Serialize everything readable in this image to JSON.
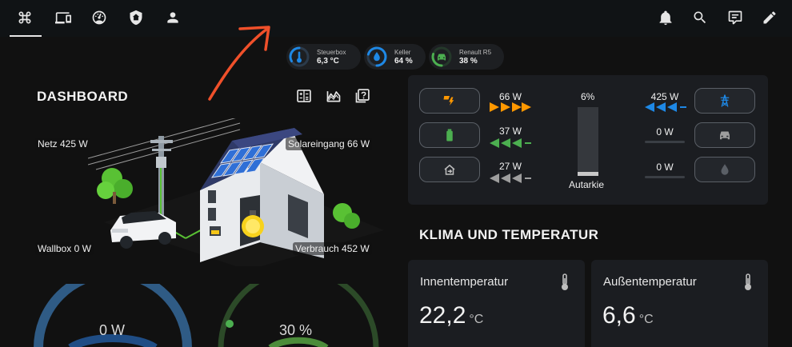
{
  "topbar": {
    "tabs": [
      {
        "icon": "command-icon",
        "active": true
      },
      {
        "icon": "devices-icon",
        "active": false
      },
      {
        "icon": "gauge-icon",
        "active": false
      },
      {
        "icon": "home-shield-icon",
        "active": false
      },
      {
        "icon": "person-icon",
        "active": false
      }
    ],
    "actions": [
      "bell-icon",
      "search-icon",
      "chat-icon",
      "pencil-icon"
    ]
  },
  "chips": [
    {
      "name": "Steuerbox",
      "value": "6,3 °C",
      "icon": "thermometer-icon",
      "color": "#1e88e5",
      "fill": 0.3
    },
    {
      "name": "Keller",
      "value": "64 %",
      "icon": "water-drop-icon",
      "color": "#1e88e5",
      "fill": 0.64
    },
    {
      "name": "Renault R5",
      "value": "38 %",
      "icon": "car-icon",
      "color": "#4caf50",
      "fill": 0.38
    }
  ],
  "dashboard": {
    "title": "DASHBOARD",
    "tools": [
      "solar-calc-icon",
      "chart-area-icon",
      "help-box-icon"
    ],
    "labels": {
      "grid": "Netz 425 W",
      "solar": "Solareingang 66 W",
      "wallbox": "Wallbox 0 W",
      "consumption": "Verbrauch 452 W"
    }
  },
  "gauges": [
    {
      "value": "0 W",
      "color": "#2f5b85",
      "fill": 0.0
    },
    {
      "value": "30 %",
      "color": "#4c8c3a",
      "fill": 0.3
    }
  ],
  "energy": {
    "solar": {
      "value": "66 W",
      "color": "#ff9800"
    },
    "battery": {
      "value": "37 W",
      "color": "#4caf50"
    },
    "home": {
      "value": "27 W",
      "color": "#9e9e9e"
    },
    "grid": {
      "value": "425 W",
      "color": "#1e88e5"
    },
    "car": {
      "value": "0 W"
    },
    "water": {
      "value": "0 W"
    },
    "autarkie": {
      "percent": "6%",
      "label": "Autarkie",
      "fill": 0.06
    }
  },
  "klima": {
    "title": "KLIMA UND TEMPERATUR",
    "cards": [
      {
        "name": "Innentemperatur",
        "value": "22,2",
        "unit": "°C"
      },
      {
        "name": "Außentemperatur",
        "value": "6,6",
        "unit": "°C"
      }
    ]
  },
  "colors": {
    "background": "#111111",
    "card": "#1b1d21",
    "accent_orange": "#ff9800",
    "accent_green": "#4caf50",
    "accent_blue": "#1e88e5",
    "annotation_red": "#f0502a"
  }
}
